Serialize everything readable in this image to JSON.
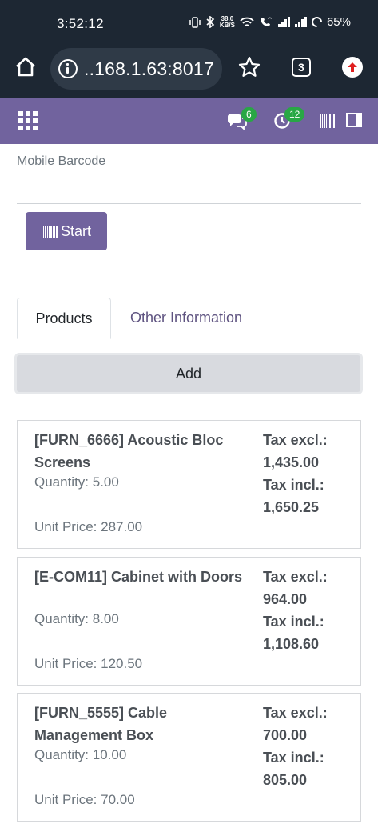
{
  "status_bar": {
    "time": "3:52:12",
    "net_speed_value": "38.0",
    "net_speed_unit": "KB/S",
    "battery": "65%"
  },
  "browser": {
    "url": "..168.1.63:8017",
    "tab_count": "3",
    "icons": [
      "home-icon",
      "info-icon",
      "star-icon",
      "tabs-icon",
      "update-icon"
    ]
  },
  "navbar": {
    "messages_count": "6",
    "activities_count": "12",
    "icons": [
      "apps-icon",
      "chat-icon",
      "clock-icon",
      "barcode-icon",
      "panel-icon"
    ],
    "accent_color": "#71639e",
    "badge_color": "#28a745"
  },
  "form": {
    "mobile_barcode_label": "Mobile Barcode",
    "mobile_barcode_value": "",
    "start_label": "Start"
  },
  "tabs": [
    {
      "label": "Products",
      "active": true
    },
    {
      "label": "Other Information",
      "active": false
    }
  ],
  "add_label": "Add",
  "products": [
    {
      "name": "[FURN_6666] Acoustic Bloc Screens",
      "quantity": "Quantity: 5.00",
      "unit_price": "Unit Price: 287.00",
      "tax_excl_label": "Tax excl.:",
      "tax_excl": "1,435.00",
      "tax_incl_label": "Tax incl.:",
      "tax_incl": "1,650.25"
    },
    {
      "name": "[E-COM11] Cabinet with Doors",
      "quantity": "Quantity: 8.00",
      "unit_price": "Unit Price: 120.50",
      "tax_excl_label": "Tax excl.:",
      "tax_excl": "964.00",
      "tax_incl_label": "Tax incl.:",
      "tax_incl": "1,108.60"
    },
    {
      "name": "[FURN_5555] Cable Management Box",
      "quantity": "Quantity: 10.00",
      "unit_price": "Unit Price: 70.00",
      "tax_excl_label": "Tax excl.:",
      "tax_excl": "700.00",
      "tax_incl_label": "Tax incl.:",
      "tax_incl": "805.00"
    }
  ]
}
